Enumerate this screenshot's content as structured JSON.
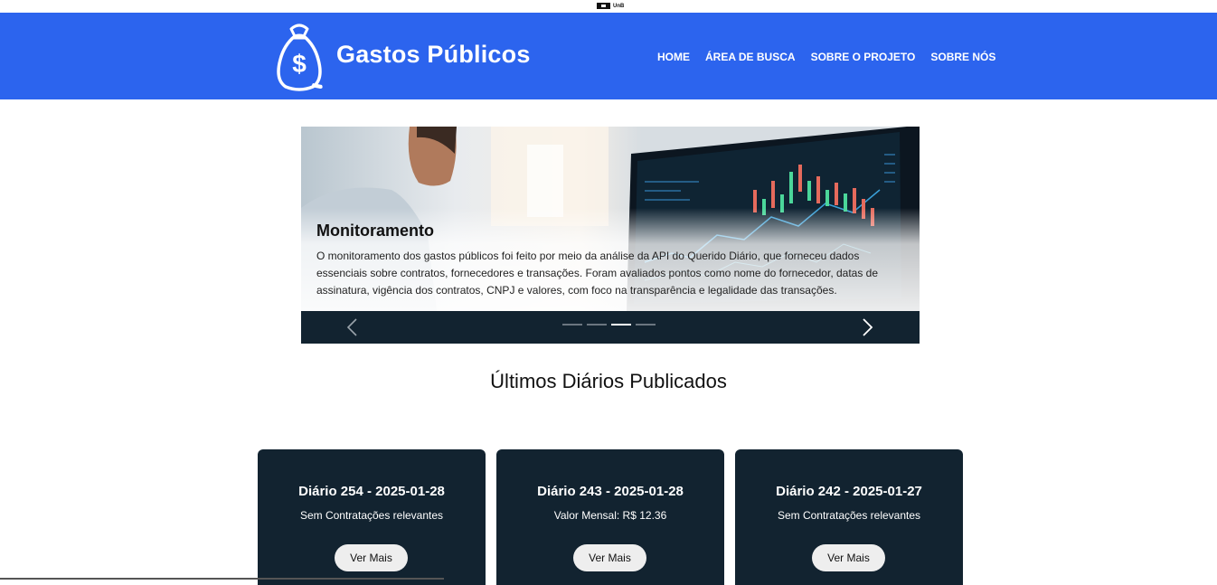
{
  "topbar": {
    "label": "UnB"
  },
  "header": {
    "brand": "Gastos Públicos",
    "logo_icon": "money-bag-icon",
    "nav": [
      {
        "label": "HOME"
      },
      {
        "label": "ÁREA DE BUSCA"
      },
      {
        "label": "SOBRE O PROJETO"
      },
      {
        "label": "SOBRE NÓS"
      }
    ],
    "background": "#2c64ee"
  },
  "carousel": {
    "title": "Monitoramento",
    "text": "O monitoramento dos gastos públicos foi feito por meio da análise da API do Querido Diário, que forneceu dados essenciais sobre contratos, fornecedores e transações. Foram avaliados pontos como nome do fornecedor, datas de assinatura, vigência dos contratos, CNPJ e valores, com foco na transparência e legalidade das transações.",
    "indicator_count": 4,
    "active_index": 2,
    "prev_icon": "chevron-left-icon",
    "next_icon": "chevron-right-icon"
  },
  "section": {
    "title": "Últimos Diários Publicados"
  },
  "cards": [
    {
      "title": "Diário 254 - 2025-01-28",
      "subtitle": "Sem Contratações relevantes",
      "button": "Ver Mais"
    },
    {
      "title": "Diário 243 - 2025-01-28",
      "subtitle": "Valor Mensal: R$ 12.36",
      "button": "Ver Mais"
    },
    {
      "title": "Diário 242 - 2025-01-27",
      "subtitle": "Sem Contratações relevantes",
      "button": "Ver Mais"
    }
  ],
  "colors": {
    "accent": "#2c64ee",
    "dark": "#122330"
  }
}
